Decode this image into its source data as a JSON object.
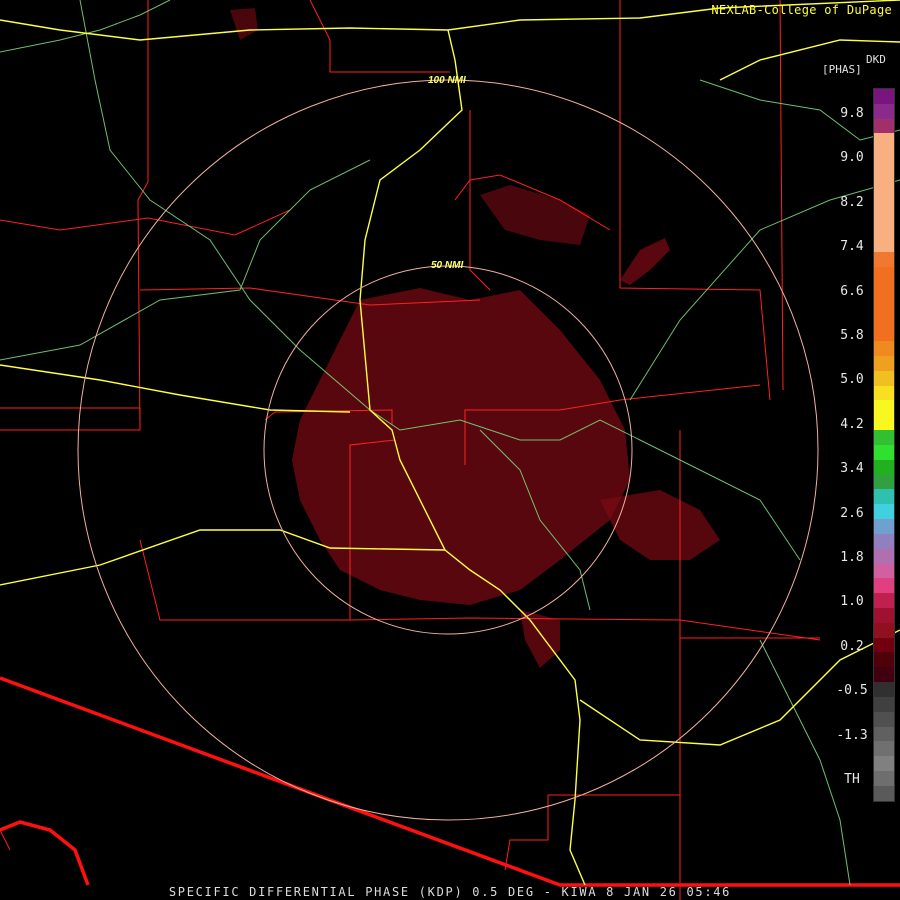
{
  "credit": "NEXLAB-College of DuPage",
  "footer": "SPECIFIC DIFFERENTIAL PHASE (KDP) 0.5 DEG - KIWA 8 JAN 26 05:46",
  "range_rings": [
    {
      "label": "100 NMI"
    },
    {
      "label": "50 NMI"
    }
  ],
  "legend": {
    "product": "DKD",
    "units": "[PHAS]",
    "ticks": [
      "9.8",
      "9.0",
      "8.2",
      "7.4",
      "6.6",
      "5.8",
      "5.0",
      "4.2",
      "3.4",
      "2.6",
      "1.8",
      "1.0",
      "0.2",
      "-0.5",
      "-1.3",
      "TH"
    ],
    "colors": [
      "#7a1580",
      "#8a2a8a",
      "#a0306a",
      "#f8b080",
      "#f8b080",
      "#f8b080",
      "#f8b080",
      "#f8b080",
      "#f8b080",
      "#f8b080",
      "#f8b080",
      "#f07830",
      "#f07020",
      "#f07020",
      "#f07020",
      "#f07020",
      "#f07020",
      "#f08a20",
      "#f0a020",
      "#f0c020",
      "#f8e020",
      "#f8f820",
      "#f8f820",
      "#30c030",
      "#30e030",
      "#20b020",
      "#30a040",
      "#30c0b0",
      "#40d0e0",
      "#70a0d0",
      "#9080c0",
      "#b070b0",
      "#d060a0",
      "#e04080",
      "#c02050",
      "#a01030",
      "#901020",
      "#700010",
      "#500008",
      "#400010",
      "#303030",
      "#404040",
      "#505050",
      "#606060",
      "#707070",
      "#808080",
      "#6e6e6e",
      "#5a5a5a"
    ]
  },
  "colors": {
    "county_lines": "#ff2020",
    "border": "#ff1010",
    "highways": "#ffff40",
    "rivers": "#80e080",
    "rings": "#f0b0a0",
    "echo": "#7a0a14"
  }
}
